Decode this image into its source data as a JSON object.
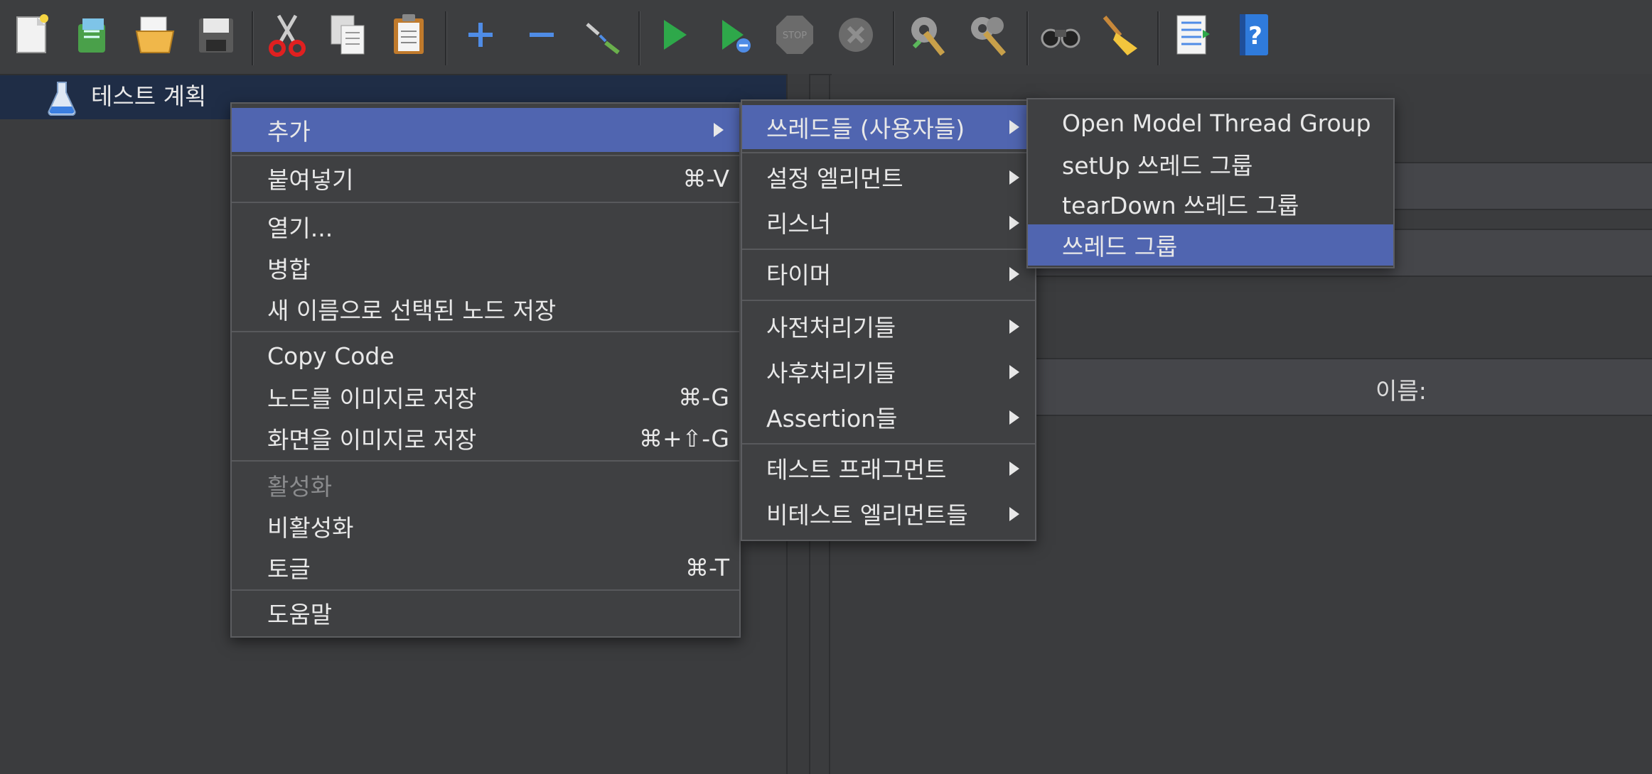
{
  "tree": {
    "root_label": "테스트 계획"
  },
  "toolbar": {
    "buttons": [
      {
        "name": "new-icon"
      },
      {
        "name": "templates-icon"
      },
      {
        "name": "open-icon"
      },
      {
        "name": "save-icon"
      },
      {
        "name": "cut-icon"
      },
      {
        "name": "copy-icon"
      },
      {
        "name": "paste-icon"
      },
      {
        "name": "expand-icon"
      },
      {
        "name": "collapse-icon"
      },
      {
        "name": "toggle-icon"
      },
      {
        "name": "start-icon"
      },
      {
        "name": "start-no-pause-icon"
      },
      {
        "name": "stop-icon"
      },
      {
        "name": "shutdown-icon"
      },
      {
        "name": "clear-icon"
      },
      {
        "name": "clear-all-icon"
      },
      {
        "name": "search-icon"
      },
      {
        "name": "reset-search-icon"
      },
      {
        "name": "function-helper-icon"
      },
      {
        "name": "help-icon"
      }
    ],
    "stop_text": "STOP"
  },
  "right_panel": {
    "column_name_label": "이름:"
  },
  "context_menu": {
    "add": "추가",
    "paste": "붙여넣기",
    "paste_shortcut": "⌘-V",
    "open": "열기...",
    "merge": "병합",
    "save_as": "새 이름으로 선택된 노드 저장",
    "copy_code": "Copy Code",
    "save_node_image": "노드를 이미지로 저장",
    "save_node_image_shortcut": "⌘-G",
    "save_screen_image": "화면을 이미지로 저장",
    "save_screen_image_shortcut": "⌘+⇧-G",
    "enable": "활성화",
    "disable": "비활성화",
    "toggle": "토글",
    "toggle_shortcut": "⌘-T",
    "help": "도움말"
  },
  "add_submenu": {
    "threads": "쓰레드들 (사용자들)",
    "config": "설정 엘리먼트",
    "listener": "리스너",
    "timer": "타이머",
    "preprocessors": "사전처리기들",
    "postprocessors": "사후처리기들",
    "assertions": "Assertion들",
    "test_fragment": "테스트 프래그먼트",
    "non_test": "비테스트 엘리먼트들"
  },
  "threads_submenu": {
    "open_model": "Open Model Thread Group",
    "setup": "setUp 쓰레드 그룹",
    "teardown": "tearDown 쓰레드 그룹",
    "thread_group": "쓰레드 그룹"
  },
  "colors": {
    "menu_bg": "#3f4042",
    "selection": "#5065b0",
    "tree_selection": "#1f2d46"
  }
}
